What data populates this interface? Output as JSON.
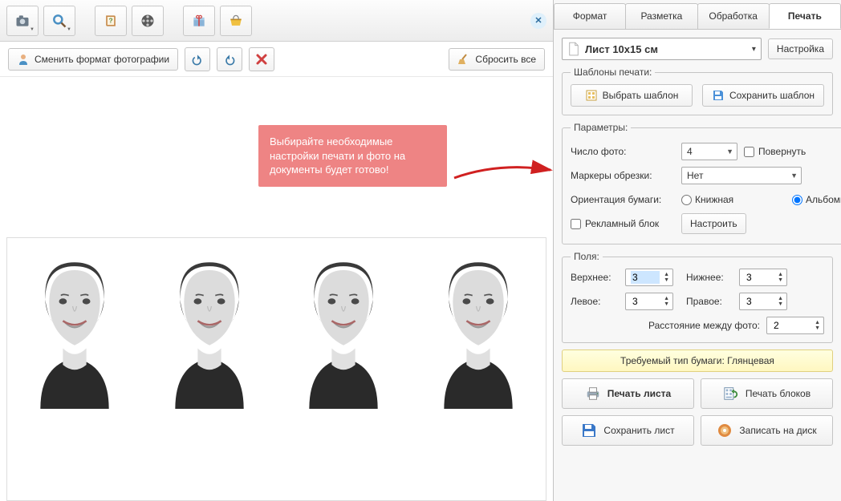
{
  "toolbar": {
    "icons": [
      "camera",
      "magnifier",
      "book-help",
      "film-reel",
      "gift-box",
      "basket"
    ]
  },
  "subtoolbar": {
    "change_format_label": "Сменить формат фотографии",
    "reset_all_label": "Сбросить все"
  },
  "callout": {
    "text": "Выбирайте необходимые настройки печати и фото на документы будет готово!"
  },
  "tabs": {
    "format": "Формат",
    "layout": "Разметка",
    "processing": "Обработка",
    "print": "Печать",
    "active": "print"
  },
  "sheet": {
    "label": "Лист 10х15 см",
    "settings_button": "Настройка"
  },
  "templates": {
    "legend": "Шаблоны печати:",
    "choose_label": "Выбрать шаблон",
    "save_label": "Сохранить шаблон"
  },
  "params": {
    "legend": "Параметры:",
    "photo_count_label": "Число фото:",
    "photo_count_value": "4",
    "rotate_label": "Повернуть",
    "rotate_checked": false,
    "crop_markers_label": "Маркеры обрезки:",
    "crop_markers_value": "Нет",
    "orientation_label": "Ориентация бумаги:",
    "orientation_portrait": "Книжная",
    "orientation_landscape": "Альбомная",
    "orientation_value": "landscape",
    "ad_block_label": "Рекламный блок",
    "ad_block_checked": false,
    "ad_configure_label": "Настроить"
  },
  "margins": {
    "legend": "Поля:",
    "top_label": "Верхнее:",
    "top_value": "3",
    "bottom_label": "Нижнее:",
    "bottom_value": "3",
    "left_label": "Левое:",
    "left_value": "3",
    "right_label": "Правое:",
    "right_value": "3",
    "spacing_label": "Расстояние между фото:",
    "spacing_value": "2"
  },
  "paper": {
    "text": "Требуемый тип бумаги: Глянцевая"
  },
  "actions": {
    "print_sheet": "Печать листа",
    "print_blocks": "Печать блоков",
    "save_sheet": "Сохранить лист",
    "burn_disc": "Записать на диск"
  },
  "preview": {
    "photo_count": 4
  }
}
